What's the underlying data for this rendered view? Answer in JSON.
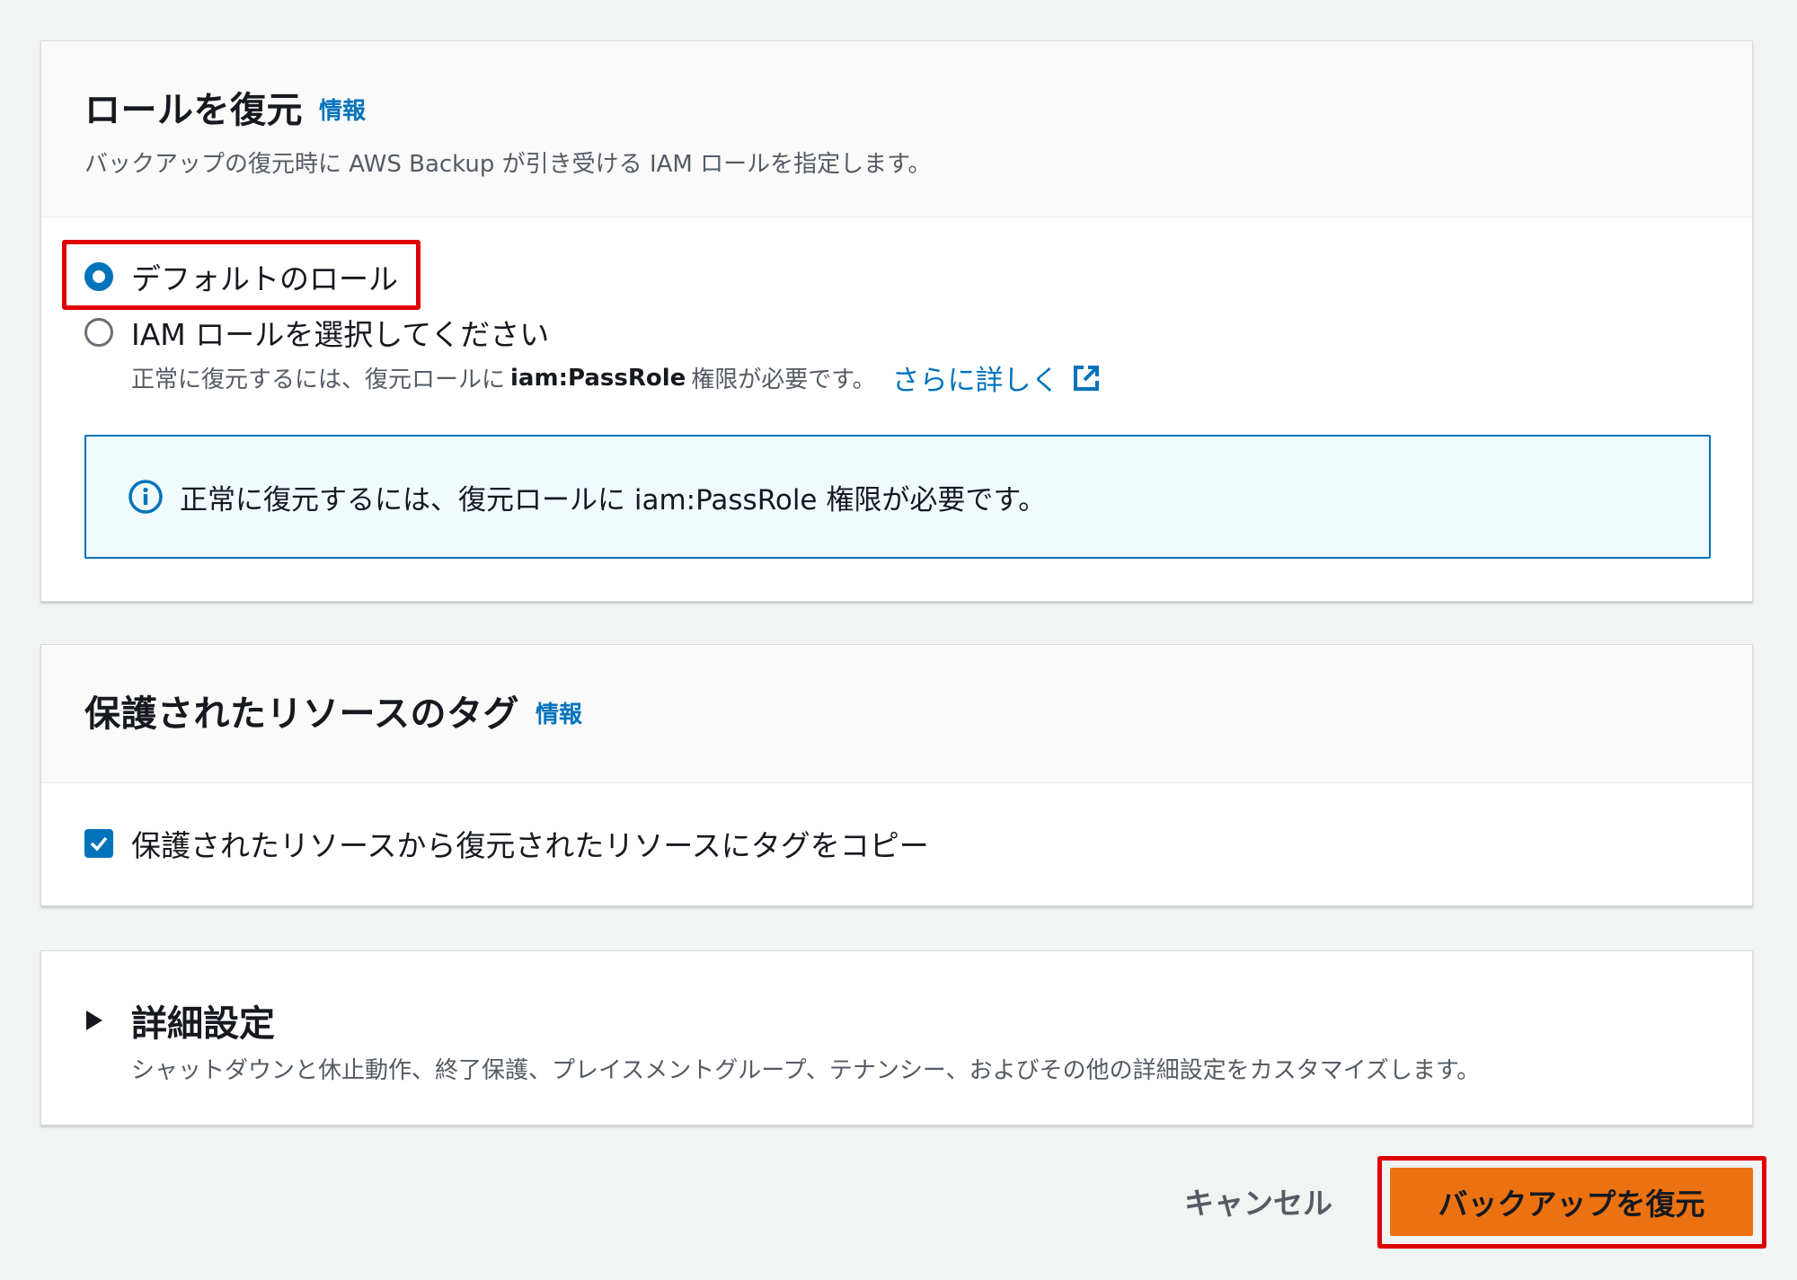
{
  "role_section": {
    "title": "ロールを復元",
    "info_label": "情報",
    "description": "バックアップの復元時に AWS Backup が引き受ける IAM ロールを指定します。",
    "options": [
      {
        "label": "デフォルトのロール",
        "selected": true
      },
      {
        "label": "IAM ロールを選択してください",
        "selected": false
      }
    ],
    "hint_prefix": "正常に復元するには、復元ロールに",
    "hint_code": "iam:PassRole",
    "hint_suffix": "権限が必要です。",
    "learn_more_label": "さらに詳しく",
    "alert_text": "正常に復元するには、復元ロールに iam:PassRole 権限が必要です。"
  },
  "tags_section": {
    "title": "保護されたリソースのタグ",
    "info_label": "情報",
    "checkbox_label": "保護されたリソースから復元されたリソースにタグをコピー",
    "checked": true
  },
  "advanced_section": {
    "title": "詳細設定",
    "description": "シャットダウンと休止動作、終了保護、プレイスメントグループ、テナンシー、およびその他の詳細設定をカスタマイズします。",
    "expanded": false
  },
  "footer": {
    "cancel_label": "キャンセル",
    "primary_label": "バックアップを復元"
  },
  "colors": {
    "accent": "#0073bb",
    "primary_button": "#ec7211",
    "highlight": "#e00000"
  }
}
